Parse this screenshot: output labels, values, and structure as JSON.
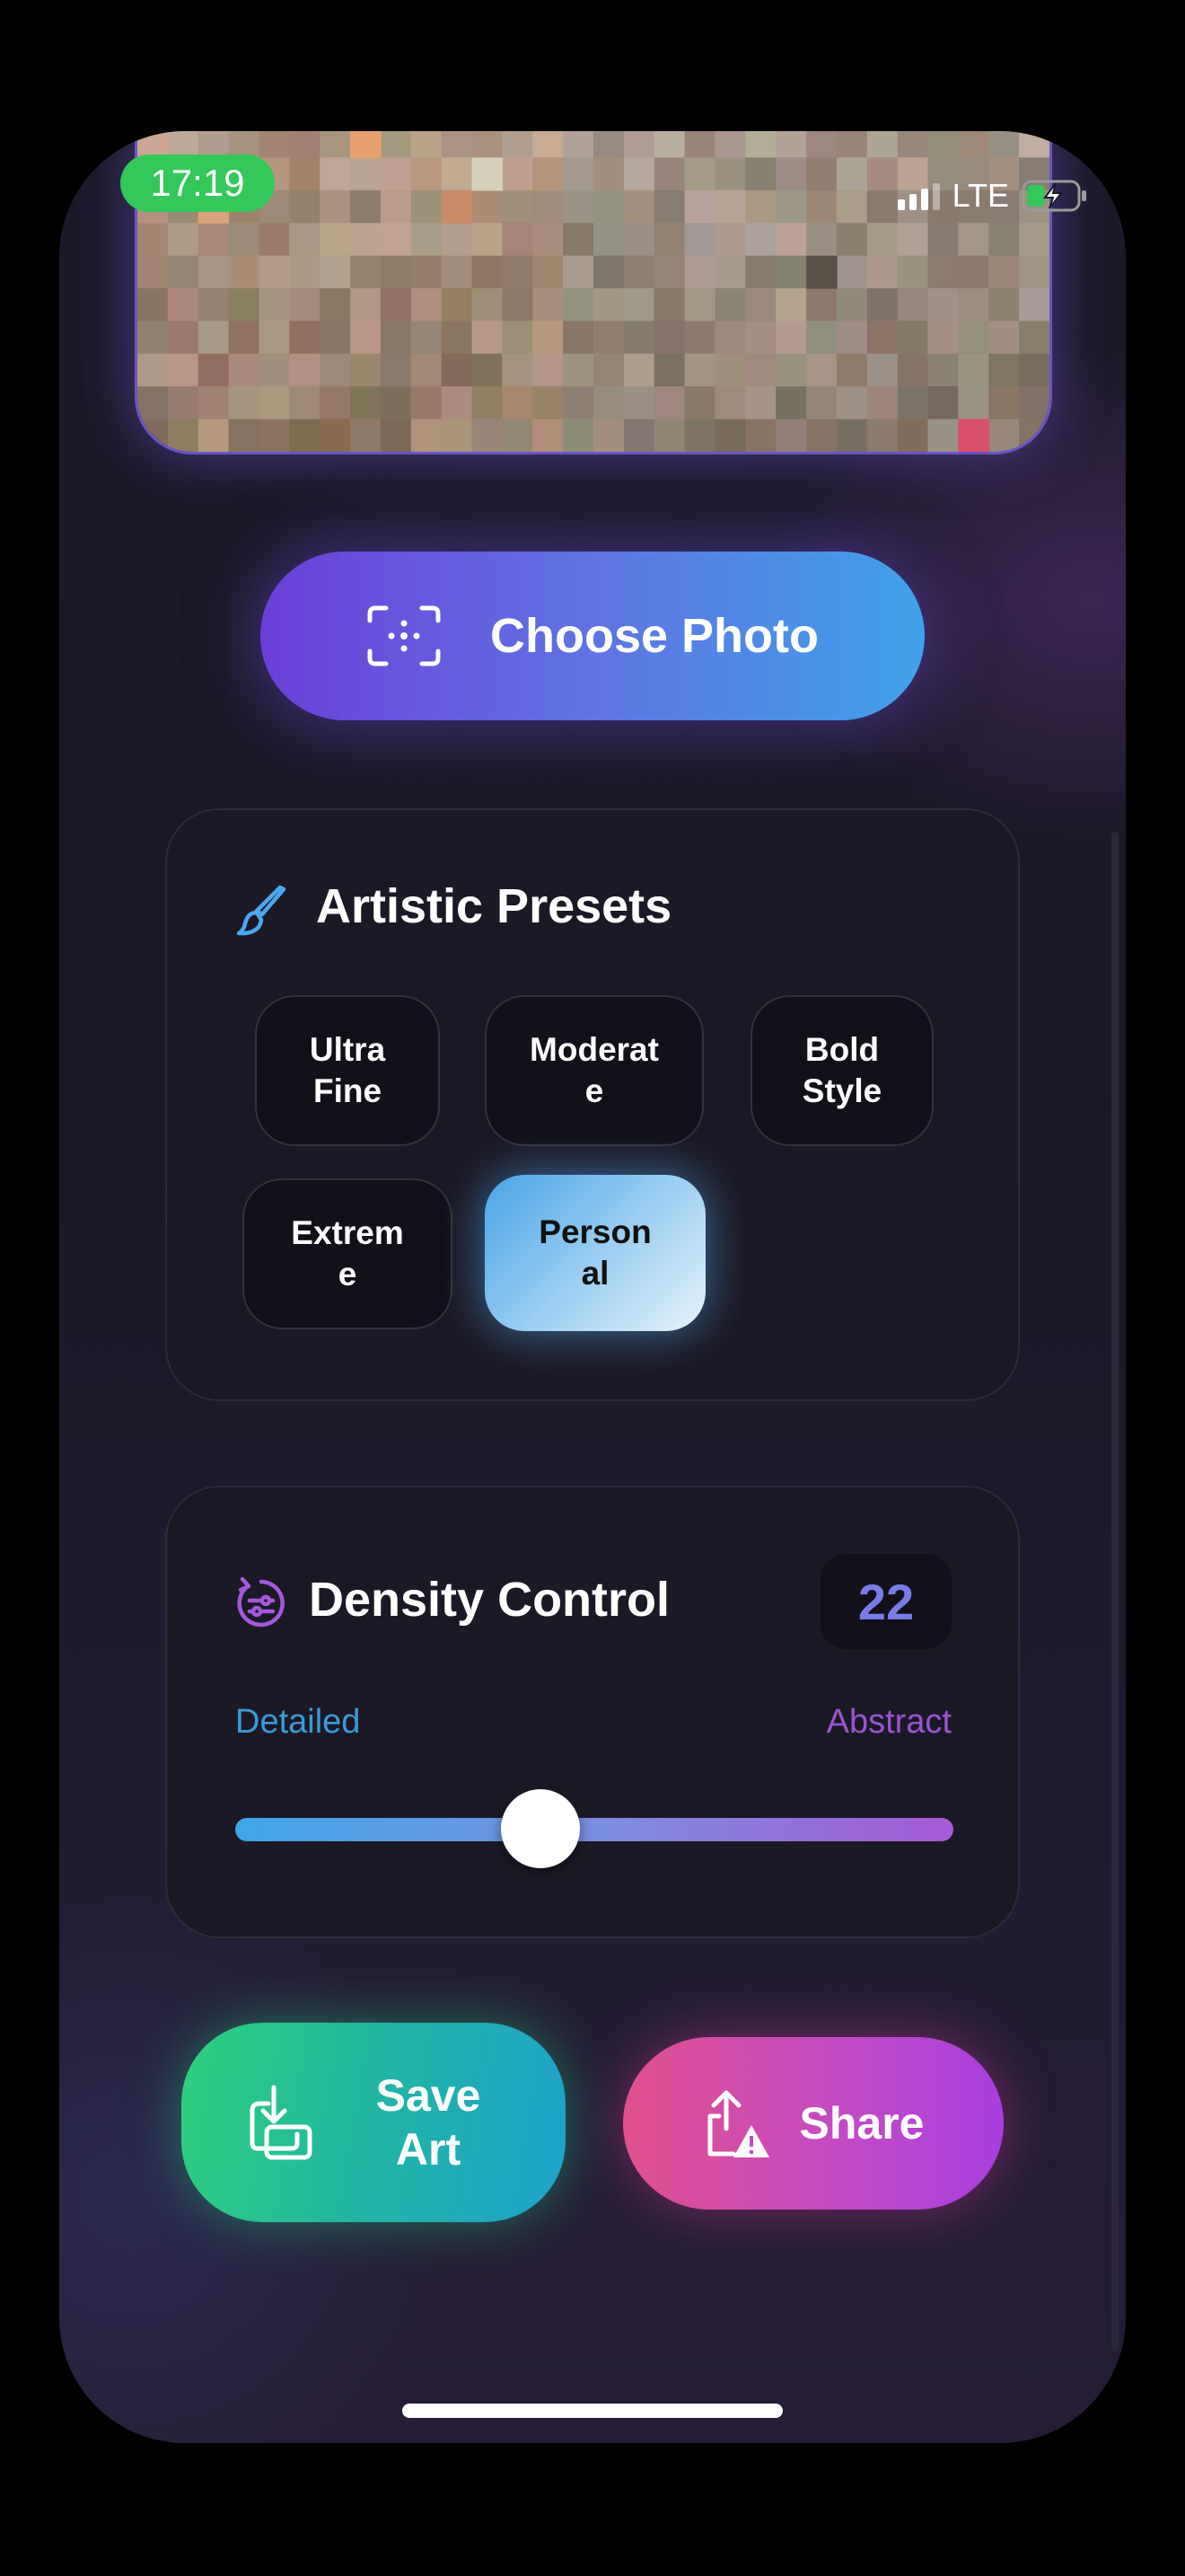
{
  "status_bar": {
    "time": "17:19",
    "network": "LTE"
  },
  "photo": {
    "description_icon": "pixelated-photo"
  },
  "choose_photo": {
    "label": "Choose Photo",
    "icon": "photo-select-icon"
  },
  "presets": {
    "title": "Artistic Presets",
    "icon": "paintbrush-icon",
    "items": [
      {
        "label": "Ultra Fine",
        "selected": false
      },
      {
        "label": "Moderate",
        "selected": false
      },
      {
        "label": "Bold Style",
        "selected": false
      },
      {
        "label": "Extreme",
        "selected": false
      },
      {
        "label": "Personal",
        "selected": true
      }
    ]
  },
  "density": {
    "title": "Density Control",
    "icon": "density-dial-icon",
    "value": "22",
    "min_label": "Detailed",
    "max_label": "Abstract",
    "slider_fraction": 0.425
  },
  "actions": {
    "save_label": "Save Art",
    "share_label": "Share"
  },
  "colors": {
    "accent_purple": "#6c3fd8",
    "accent_blue": "#3fa2ea",
    "save_green": "#2fd07c",
    "share_pink": "#e1508e",
    "status_green": "#34c759",
    "detailed_label": "#3a9bd8",
    "abstract_label": "#9a54cf"
  }
}
